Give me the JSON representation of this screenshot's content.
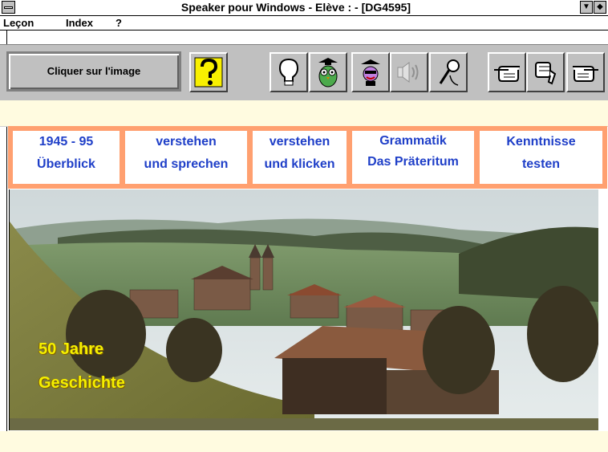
{
  "window": {
    "title": "Speaker pour Windows - Elève : - [DG4595]"
  },
  "menu": {
    "items": [
      "Leçon",
      "Index",
      "?"
    ]
  },
  "toolbar": {
    "click_label": "Cliquer sur l'image",
    "buttons": [
      {
        "name": "help-icon"
      },
      {
        "name": "lightbulb-icon"
      },
      {
        "name": "owl-graduate-icon"
      },
      {
        "name": "student-graduate-icon"
      },
      {
        "name": "speaker-icon"
      },
      {
        "name": "microphone-icon"
      },
      {
        "name": "hand-point-left-icon"
      },
      {
        "name": "thumbs-down-icon"
      },
      {
        "name": "hand-point-right-icon"
      }
    ]
  },
  "nav": {
    "items": [
      {
        "line1": "1945 - 95",
        "line2": "Überblick"
      },
      {
        "line1": "verstehen",
        "line2": "und sprechen"
      },
      {
        "line1": "verstehen",
        "line2": "und klicken"
      },
      {
        "line1": "Grammatik",
        "line2": "Das Präteritum"
      },
      {
        "line1": "Kenntnisse",
        "line2": "testen"
      }
    ]
  },
  "photo": {
    "caption_line1": "50 Jahre",
    "caption_line2": "Geschichte"
  },
  "colors": {
    "nav_border": "#ffa070",
    "nav_text": "#1f3fc8",
    "strip": "#fffbe0",
    "caption": "#f5f000"
  }
}
